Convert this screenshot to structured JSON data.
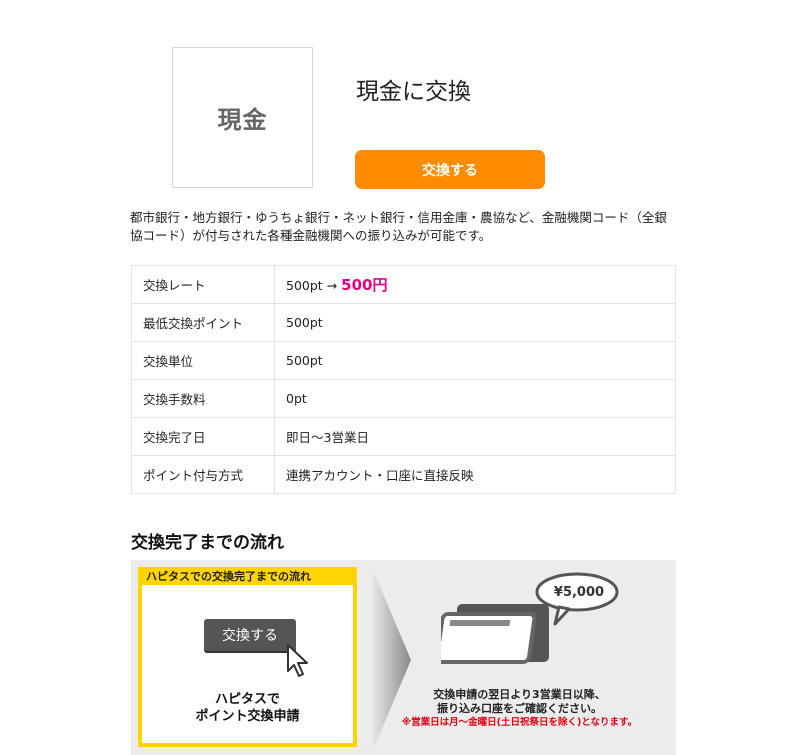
{
  "item": {
    "thumb_label": "現金",
    "title": "現金に交換",
    "button_label": "交換する"
  },
  "description": "都市銀行・地方銀行・ゆうちょ銀行・ネット銀行・信用金庫・農協など、金融機関コード（全銀協コード）が付与された各種金融機関への振り込みが可能です。",
  "info": {
    "rate_label": "交換レート",
    "rate_value": "500pt →",
    "rate_yen": "500円",
    "rows": [
      {
        "label": "最低交換ポイント",
        "value": "500pt"
      },
      {
        "label": "交換単位",
        "value": "500pt"
      },
      {
        "label": "交換手数料",
        "value": "0pt"
      },
      {
        "label": "交換完了日",
        "value": "即日～3営業日"
      },
      {
        "label": "ポイント付与方式",
        "value": "連携アカウント・口座に直接反映"
      }
    ]
  },
  "flow": {
    "heading": "交換完了までの流れ",
    "box_title": "ハピタスでの交換完了までの流れ",
    "mini_button": "交換する",
    "step1_line1": "ハピタスで",
    "step1_line2": "ポイント交換申請",
    "bubble": "¥5,000",
    "step2_line1": "交換申請の翌日より3営業日以降、",
    "step2_line2": "振り込み口座をご確認ください。",
    "step2_note": "※営業日は月～金曜日(土日祝祭日を除く)となります。"
  },
  "colors": {
    "accent": "#ff8c00",
    "yen": "#e6007e",
    "flow_frame": "#ffd400"
  }
}
